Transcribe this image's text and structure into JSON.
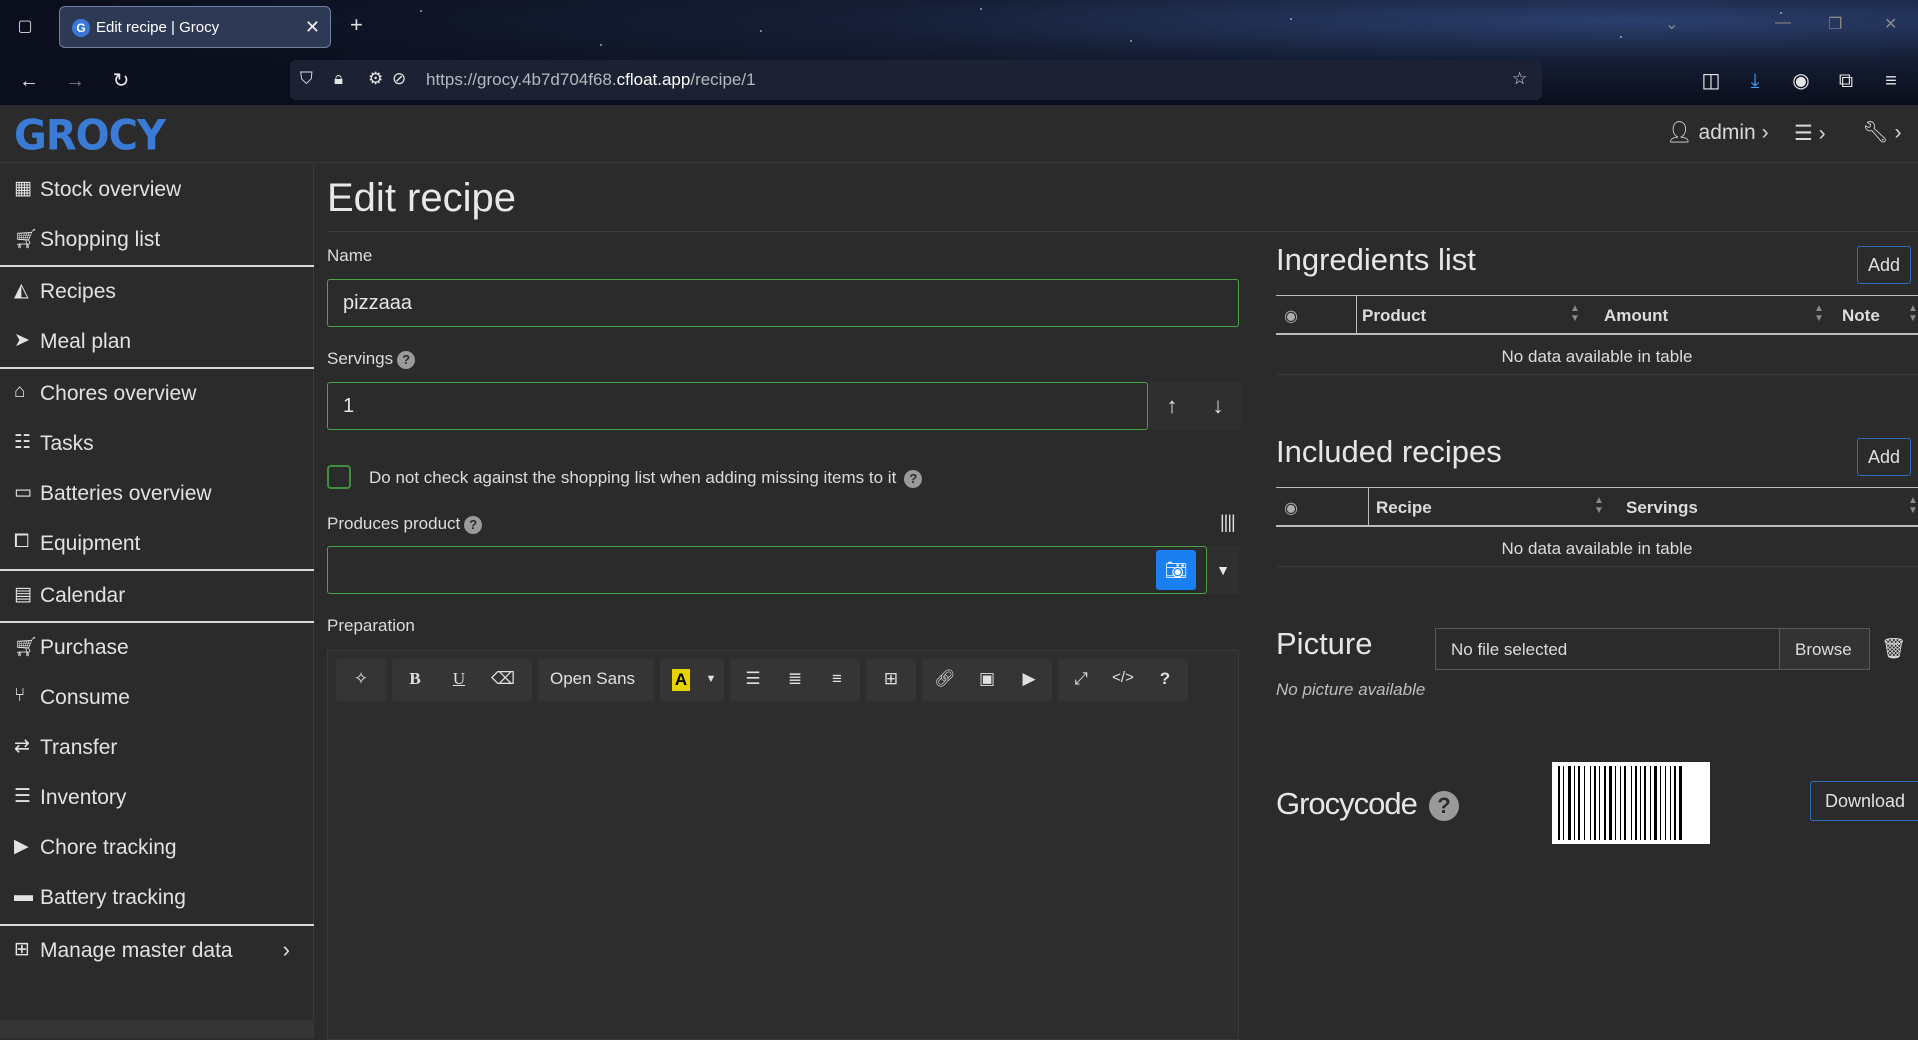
{
  "browser": {
    "tab_title": "Edit recipe | Grocy",
    "tab_favicon": "G",
    "url_prefix": "https://grocy.4b7d704f68.",
    "url_host": "cfloat.app",
    "url_path": "/recipe/1"
  },
  "app": {
    "logo": "GROCY",
    "user": "admin",
    "accent_color": "#3a7bd5"
  },
  "sidebar": {
    "items": [
      {
        "label": "Stock overview",
        "icon": "box-icon"
      },
      {
        "label": "Shopping list",
        "icon": "cart-icon"
      },
      {
        "label": "Recipes",
        "icon": "pizza-icon"
      },
      {
        "label": "Meal plan",
        "icon": "paper-plane-icon"
      },
      {
        "label": "Chores overview",
        "icon": "home-icon"
      },
      {
        "label": "Tasks",
        "icon": "tasks-icon"
      },
      {
        "label": "Batteries overview",
        "icon": "battery-icon"
      },
      {
        "label": "Equipment",
        "icon": "toolbox-icon"
      },
      {
        "label": "Calendar",
        "icon": "calendar-icon"
      },
      {
        "label": "Purchase",
        "icon": "cart-plus-icon"
      },
      {
        "label": "Consume",
        "icon": "utensils-icon"
      },
      {
        "label": "Transfer",
        "icon": "exchange-icon"
      },
      {
        "label": "Inventory",
        "icon": "list-icon"
      },
      {
        "label": "Chore tracking",
        "icon": "play-icon"
      },
      {
        "label": "Battery tracking",
        "icon": "car-battery-icon"
      },
      {
        "label": "Manage master data",
        "icon": "table-icon"
      }
    ]
  },
  "page": {
    "title": "Edit recipe",
    "name_label": "Name",
    "name_value": "pizzaaa",
    "servings_label": "Servings",
    "servings_value": "1",
    "checkbox_label": "Do not check against the shopping list when adding missing items to it",
    "produces_label": "Produces product",
    "preparation_label": "Preparation",
    "font_select": "Open Sans"
  },
  "ingredients": {
    "title": "Ingredients list",
    "add_label": "Add",
    "columns": [
      "Product",
      "Amount",
      "Note"
    ],
    "empty_text": "No data available in table"
  },
  "included": {
    "title": "Included recipes",
    "add_label": "Add",
    "columns": [
      "Recipe",
      "Servings"
    ],
    "empty_text": "No data available in table"
  },
  "picture": {
    "title": "Picture",
    "file_text": "No file selected",
    "browse_label": "Browse",
    "none_text": "No picture available"
  },
  "grocycode": {
    "title": "Grocycode",
    "download_label": "Download"
  }
}
